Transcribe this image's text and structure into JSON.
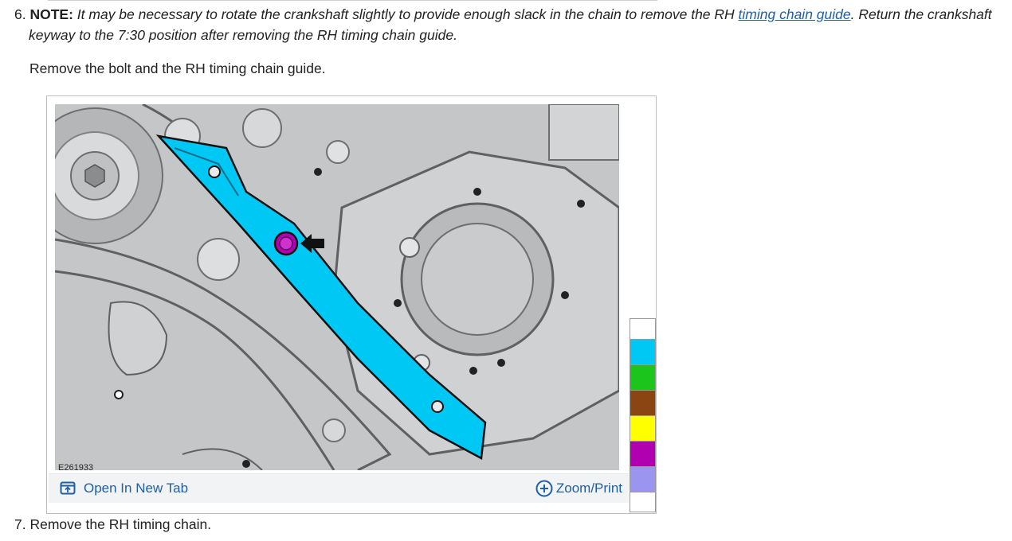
{
  "steps": {
    "step6": {
      "number": "6.",
      "note_label": "NOTE:",
      "note_text_before": " It may be necessary to rotate the crankshaft slightly to provide enough slack in the chain to remove the RH ",
      "note_link": "timing chain guide",
      "note_text_after": ". Return the crankshaft",
      "note_line2": "keyway to the 7:30 position after removing the RH timing chain guide.",
      "instruction": "Remove the bolt and the RH timing chain guide."
    },
    "step7": {
      "number": "7.",
      "text": "Remove the RH timing chain."
    }
  },
  "figure": {
    "id": "E261933",
    "open_tab_label": "Open In New Tab",
    "zoom_label": "Zoom/Print",
    "highlight_colors": [
      "#ffffff",
      "#00c8f5",
      "#1cc51c",
      "#8b4513",
      "#ffff00",
      "#b000b0",
      "#9b95f0",
      "#ffffff"
    ],
    "icons": {
      "open_tab": "open-new-tab-icon",
      "zoom": "plus-circle-icon",
      "fastener": "bolt-icon",
      "pointer": "arrow-icon"
    }
  }
}
